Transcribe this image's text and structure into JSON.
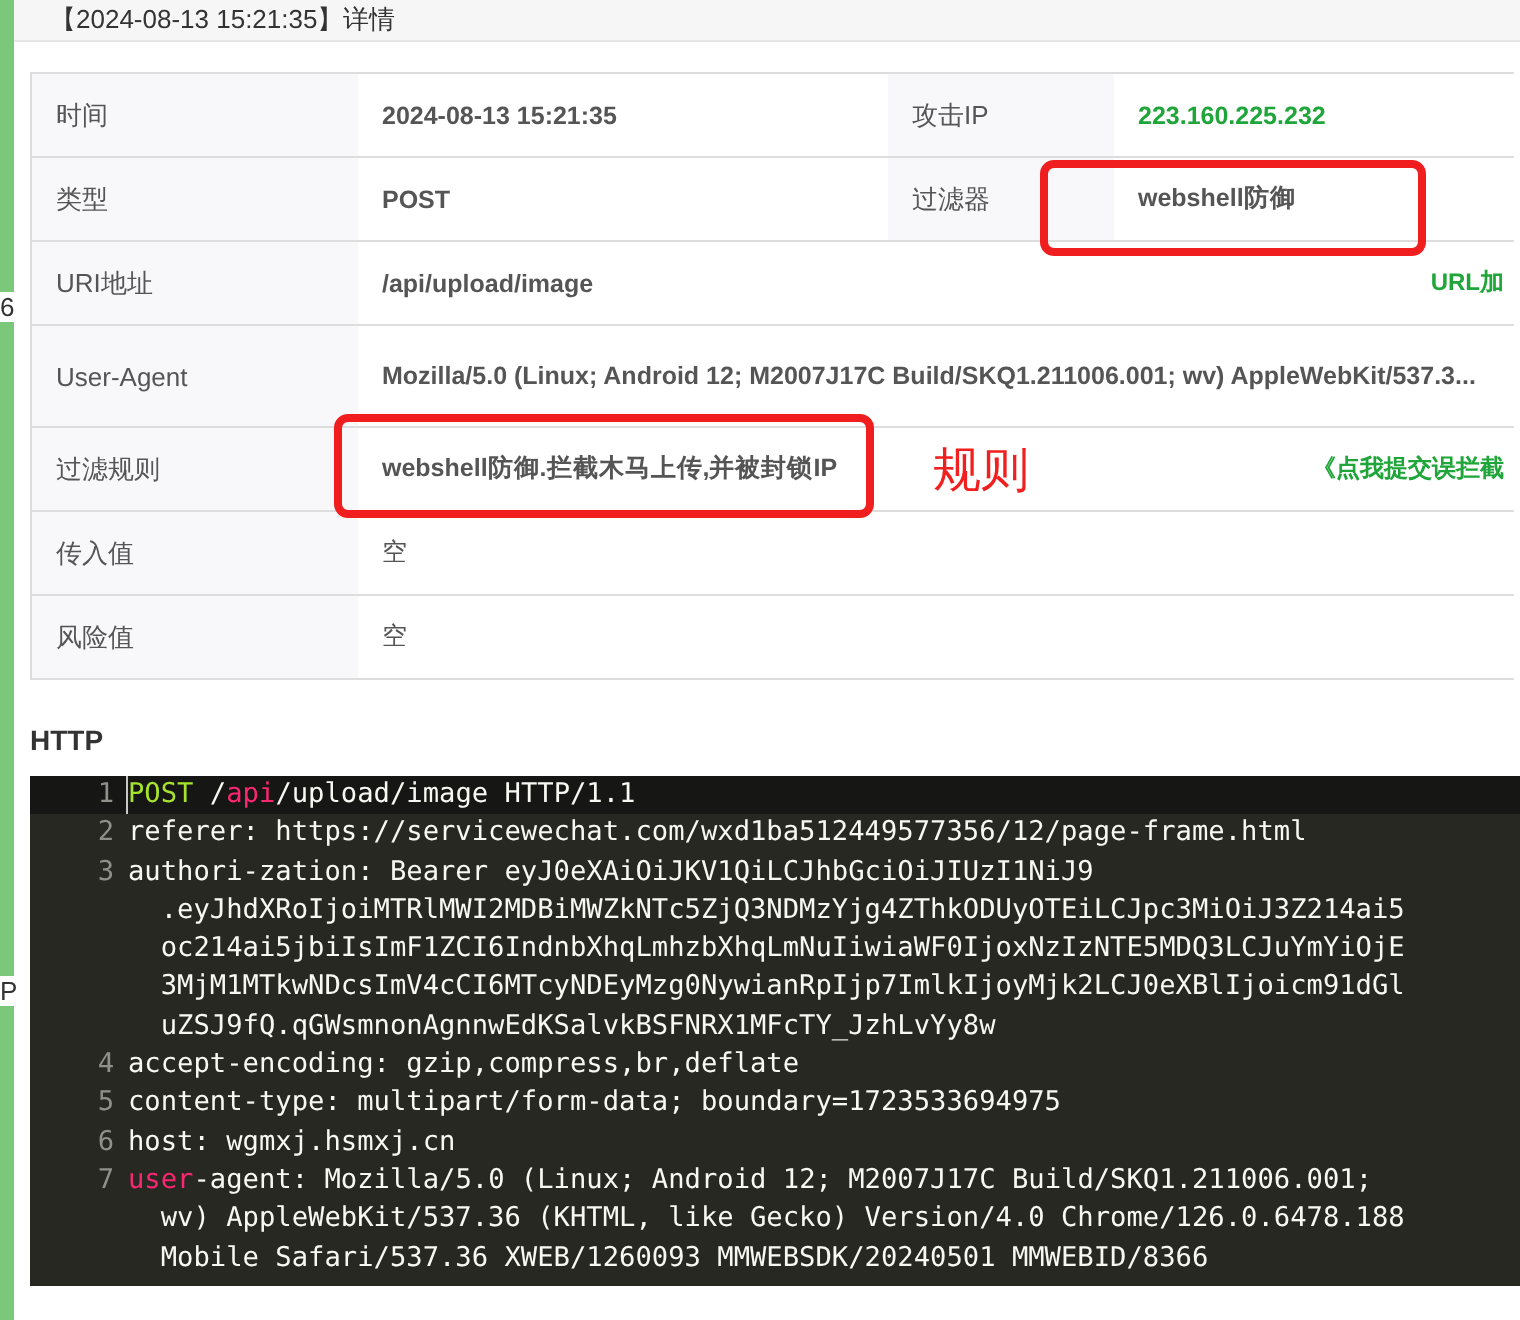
{
  "background_fragments": [
    "6",
    "P"
  ],
  "dialog": {
    "title": "【2024-08-13 15:21:35】详情"
  },
  "details": [
    {
      "kind": "pair-ip",
      "label": "时间",
      "value": "2024-08-13 15:21:35",
      "label2": "攻击IP",
      "value2": "223.160.225.232",
      "value2_marked": false
    },
    {
      "kind": "pair",
      "label": "类型",
      "value": "POST",
      "label2": "过滤器",
      "value2": "webshell防御",
      "value2_marked": true
    },
    {
      "kind": "single",
      "label": "URI地址",
      "value": "/api/upload/image",
      "link": "URL加",
      "marked": false
    },
    {
      "kind": "single",
      "label": "User-Agent",
      "value": "Mozilla/5.0 (Linux; Android 12; M2007J17C Build/SKQ1.211006.001; wv) AppleWebKit/537.3...",
      "marked": false
    },
    {
      "kind": "single",
      "label": "过滤规则",
      "value": "webshell防御.拦截木马上传,并被封锁IP",
      "link": "《点我提交误拦截",
      "marked": true,
      "note": "规则"
    },
    {
      "kind": "single-empty",
      "label": "传入值",
      "value": "空",
      "marked": false
    },
    {
      "kind": "single-empty",
      "label": "风险值",
      "value": "空",
      "marked": false
    }
  ],
  "http": {
    "heading": "HTTP",
    "lines": [
      {
        "number": "1",
        "active": true,
        "rows": [
          [
            {
              "text": "POST",
              "kind": "keyword"
            },
            {
              "text": " /",
              "kind": "plain"
            },
            {
              "text": "api",
              "kind": "tag"
            },
            {
              "text": "/upload/image HTTP/1.1",
              "kind": "plain"
            }
          ]
        ]
      },
      {
        "number": "2",
        "active": false,
        "rows": [
          [
            {
              "text": "referer: https://servicewechat.com/wxd1ba512449577356/12/page-frame.html",
              "kind": "plain"
            }
          ]
        ]
      },
      {
        "number": "3",
        "active": false,
        "rows": [
          [
            {
              "text": "authori-zation: Bearer eyJ0eXAiOiJKV1QiLCJhbGciOiJIUzI1NiJ9",
              "kind": "plain"
            }
          ],
          [
            {
              "text": "  .eyJhdXRoIjoiMTRlMWI2MDBiMWZkNTc5ZjQ3NDMzYjg4ZThkODUyOTEiLCJpc3MiOiJ3Z214ai5",
              "kind": "plain"
            }
          ],
          [
            {
              "text": "  oc214ai5jbiIsImF1ZCI6IndnbXhqLmhzbXhqLmNuIiwiaWF0IjoxNzIzNTE5MDQ3LCJuYmYiOjE",
              "kind": "plain"
            }
          ],
          [
            {
              "text": "  3MjM1MTkwNDcsImV4cCI6MTcyNDEyMzg0NywianRpIjp7ImlkIjoyMjk2LCJ0eXBlIjoicm91dGl",
              "kind": "plain"
            }
          ],
          [
            {
              "text": "  uZSJ9fQ.qGWsmnonAgnnwEdKSalvkBSFNRX1MFcTY_JzhLvYy8w",
              "kind": "plain"
            }
          ]
        ]
      },
      {
        "number": "4",
        "active": false,
        "rows": [
          [
            {
              "text": "accept-encoding: gzip,compress,br,deflate",
              "kind": "plain"
            }
          ]
        ]
      },
      {
        "number": "5",
        "active": false,
        "rows": [
          [
            {
              "text": "content-type: multipart/form-data; boundary=1723533694975",
              "kind": "plain"
            }
          ]
        ]
      },
      {
        "number": "6",
        "active": false,
        "rows": [
          [
            {
              "text": "host: wgmxj.hsmxj.cn",
              "kind": "plain"
            }
          ]
        ]
      },
      {
        "number": "7",
        "active": false,
        "rows": [
          [
            {
              "text": "user",
              "kind": "tag"
            },
            {
              "text": "-agent: Mozilla/5.0 (Linux; Android 12; M2007J17C Build/SKQ1.211006.001;",
              "kind": "plain"
            }
          ],
          [
            {
              "text": "  wv) AppleWebKit/537.36 (KHTML, like Gecko) Version/4.0 Chrome/126.0.6478.188",
              "kind": "plain"
            }
          ],
          [
            {
              "text": "  Mobile Safari/537.36 XWEB/1260093 MMWEBSDK/20240501 MMWEBID/8366",
              "kind": "plain"
            }
          ]
        ]
      }
    ]
  }
}
